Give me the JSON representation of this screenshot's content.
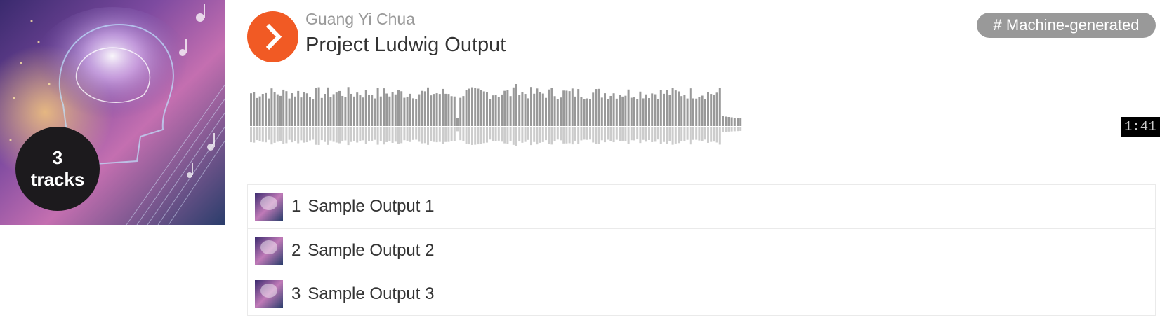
{
  "playlist": {
    "artwork_icon": "brain-music-artwork",
    "track_count_number": "3",
    "track_count_word": "tracks",
    "artist": "Guang Yi Chua",
    "title": "Project Ludwig Output",
    "tag": "# Machine-generated",
    "duration": "1:41",
    "accent_color": "#f15a24",
    "play_icon": "play-icon"
  },
  "tracks": [
    {
      "number": "1",
      "title": "Sample Output 1"
    },
    {
      "number": "2",
      "title": "Sample Output 2"
    },
    {
      "number": "3",
      "title": "Sample Output 3"
    }
  ]
}
